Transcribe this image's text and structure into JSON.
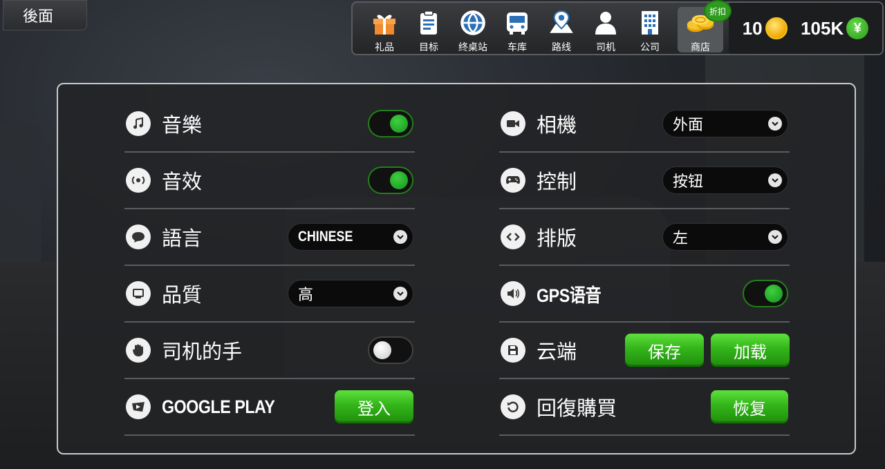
{
  "back_label": "後面",
  "nav": [
    {
      "name": "gift",
      "label": "礼品",
      "icon": "gift-icon"
    },
    {
      "name": "goals",
      "label": "目标",
      "icon": "clipboard-icon"
    },
    {
      "name": "terminal",
      "label": "终桌站",
      "icon": "globe-icon"
    },
    {
      "name": "garage",
      "label": "车库",
      "icon": "bus-icon"
    },
    {
      "name": "routes",
      "label": "路线",
      "icon": "map-pin-icon"
    },
    {
      "name": "drivers",
      "label": "司机",
      "icon": "person-icon"
    },
    {
      "name": "company",
      "label": "公司",
      "icon": "building-icon"
    }
  ],
  "shop": {
    "label": "商店",
    "badge": "折扣",
    "icon": "coins-icon"
  },
  "currency": {
    "coins": "10",
    "cash": "105K",
    "cash_symbol": "¥"
  },
  "settings_left": [
    {
      "label": "音樂",
      "icon": "music-icon",
      "control": "toggle",
      "on": true
    },
    {
      "label": "音效",
      "icon": "sound-effects-icon",
      "control": "toggle",
      "on": true
    },
    {
      "label": "語言",
      "icon": "speech-bubble-icon",
      "control": "dropdown",
      "value": "CHINESE"
    },
    {
      "label": "品質",
      "icon": "monitor-icon",
      "control": "dropdown",
      "value": "高"
    },
    {
      "label": "司机的手",
      "icon": "hand-icon",
      "control": "toggle",
      "on": false
    },
    {
      "label": "GOOGLE PLAY",
      "icon": "google-play-games-icon",
      "control": "button",
      "button": "登入"
    }
  ],
  "settings_right": [
    {
      "label": "相機",
      "icon": "camera-icon",
      "control": "dropdown",
      "value": "外面"
    },
    {
      "label": "控制",
      "icon": "gamepad-icon",
      "control": "dropdown",
      "value": "按钮"
    },
    {
      "label": "排版",
      "icon": "code-brackets-icon",
      "control": "dropdown",
      "value": "左"
    },
    {
      "label": "GPS语音",
      "icon": "speaker-icon",
      "control": "toggle",
      "on": true
    },
    {
      "label": "云端",
      "icon": "save-disk-icon",
      "control": "buttons",
      "buttons": [
        "保存",
        "加载"
      ]
    },
    {
      "label": "回復購買",
      "icon": "restore-icon",
      "control": "button",
      "button": "恢复"
    }
  ],
  "colors": {
    "accent_green": "#2ea81a",
    "panel_border": "#c9cacb"
  }
}
